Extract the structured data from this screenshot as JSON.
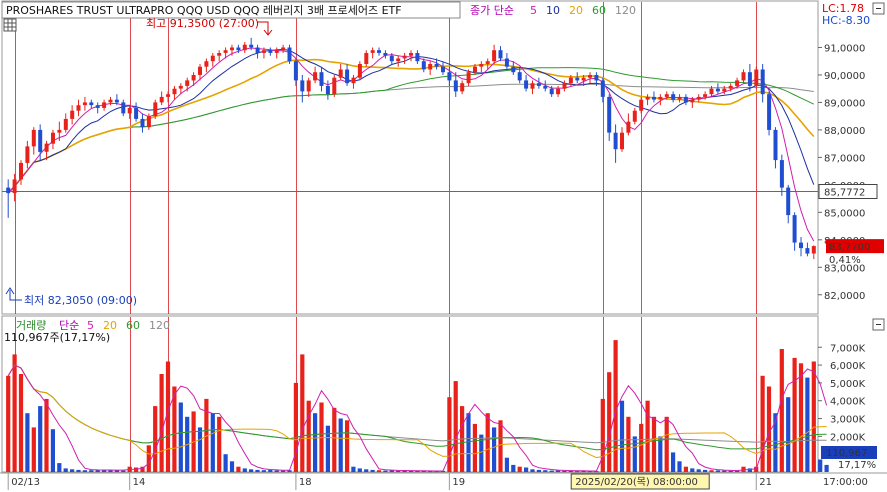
{
  "chart_data": {
    "type": "candlestick",
    "title": "PROSHARES TRUST ULTRAPRO QQQ USD  QQQ 레버리지 3배 프로세어즈 ETF",
    "legend_main": {
      "price_label": "종가",
      "ma_label": "단순",
      "ma_periods": [
        "5",
        "10",
        "20",
        "60",
        "120"
      ],
      "ma_colors": [
        "#d01fb0",
        "#1c2fa0",
        "#e6a300",
        "#2e9a2e",
        "#8c8c8c"
      ]
    },
    "lc_text": "LC:1.78",
    "hc_text": "HC:-8.30",
    "high_annotation": "최고 91,3500 (27:00)",
    "low_annotation": "최저 82,3050 (09:00)",
    "y_ticks": [
      "91,0000",
      "90,0000",
      "89,0000",
      "88,0000",
      "87,0000",
      "86,0000",
      "85,0000",
      "84,0000",
      "83,0000",
      "82,0000"
    ],
    "y_tick_values": [
      91,
      90,
      89,
      88,
      87,
      86,
      85,
      84,
      83,
      82
    ],
    "ylim": [
      81.3,
      92.0
    ],
    "crosshair_price": 85.7772,
    "crosshair_label": "85,7772",
    "last_price": 83.77,
    "last_price_label": "83,7700",
    "change_pct_label": "0,41%",
    "volume_legend": {
      "label": "거래량",
      "ma_label": "단순",
      "ma_periods": [
        "5",
        "20",
        "60",
        "120"
      ],
      "ma_colors": [
        "#d01fb0",
        "#e6a300",
        "#2e9a2e",
        "#8c8c8c"
      ]
    },
    "volume_info": "110,967주(17,17%)",
    "vol_ticks": [
      "7,000K",
      "6,000K",
      "5,000K",
      "4,000K",
      "3,000K",
      "2,000K"
    ],
    "vol_tick_values": [
      7000,
      6000,
      5000,
      4000,
      3000,
      2000
    ],
    "vol_ylim": [
      0,
      7800
    ],
    "vol_last_label": "110,967",
    "vol_last_pct": "17,17%",
    "x_labels": [
      "02/13",
      "14",
      "18",
      "19",
      "21"
    ],
    "x_label_positions": [
      0.5,
      19.5,
      45.5,
      69.5,
      117.5
    ],
    "day_boundaries": [
      1.5,
      19.5,
      25.5,
      45.5,
      69.5,
      93.5,
      99.5,
      117.5
    ],
    "x_cursor_label": "2025/02/20(목) 08:00:00",
    "x_cursor_index": 99.5,
    "x_end_label": "17:00:00",
    "candles": [
      [
        85.9,
        86.2,
        84.8,
        85.7
      ],
      [
        85.7,
        86.4,
        85.4,
        86.2
      ],
      [
        86.2,
        86.9,
        86.0,
        86.8
      ],
      [
        86.8,
        87.6,
        86.6,
        87.4
      ],
      [
        87.4,
        88.1,
        87.1,
        88.0
      ],
      [
        88.0,
        88.2,
        86.9,
        87.2
      ],
      [
        87.2,
        87.6,
        86.9,
        87.5
      ],
      [
        87.5,
        88.0,
        87.3,
        87.9
      ],
      [
        87.9,
        88.3,
        87.6,
        88.0
      ],
      [
        88.0,
        88.6,
        87.9,
        88.4
      ],
      [
        88.4,
        88.9,
        88.2,
        88.7
      ],
      [
        88.7,
        89.1,
        88.5,
        88.9
      ],
      [
        88.9,
        89.2,
        88.7,
        89.0
      ],
      [
        89.0,
        89.1,
        88.8,
        88.9
      ],
      [
        88.9,
        89.0,
        88.6,
        88.8
      ],
      [
        88.8,
        89.1,
        88.7,
        89.0
      ],
      [
        89.0,
        89.2,
        88.9,
        89.1
      ],
      [
        89.1,
        89.3,
        88.9,
        89.0
      ],
      [
        89.0,
        89.1,
        88.5,
        88.6
      ],
      [
        88.6,
        88.9,
        88.4,
        88.8
      ],
      [
        88.8,
        89.0,
        88.3,
        88.4
      ],
      [
        88.4,
        88.6,
        87.9,
        88.1
      ],
      [
        88.1,
        88.6,
        88.0,
        88.5
      ],
      [
        88.5,
        89.1,
        88.4,
        89.0
      ],
      [
        89.0,
        89.4,
        88.9,
        89.2
      ],
      [
        89.2,
        89.4,
        89.0,
        89.3
      ],
      [
        89.3,
        89.6,
        89.1,
        89.5
      ],
      [
        89.5,
        89.7,
        89.3,
        89.6
      ],
      [
        89.6,
        89.9,
        89.4,
        89.8
      ],
      [
        89.8,
        90.1,
        89.6,
        90.0
      ],
      [
        90.0,
        90.4,
        89.8,
        90.3
      ],
      [
        90.3,
        90.6,
        90.1,
        90.5
      ],
      [
        90.5,
        90.8,
        90.3,
        90.7
      ],
      [
        90.7,
        90.9,
        90.5,
        90.8
      ],
      [
        90.8,
        91.0,
        90.6,
        90.9
      ],
      [
        90.9,
        91.1,
        90.7,
        91.0
      ],
      [
        91.0,
        91.1,
        90.8,
        90.9
      ],
      [
        90.9,
        91.2,
        90.8,
        91.1
      ],
      [
        91.1,
        91.35,
        90.9,
        91.0
      ],
      [
        91.0,
        91.1,
        90.6,
        90.8
      ],
      [
        90.8,
        91.0,
        90.6,
        90.9
      ],
      [
        90.9,
        91.0,
        90.7,
        90.8
      ],
      [
        90.8,
        91.0,
        90.6,
        90.9
      ],
      [
        90.9,
        91.1,
        90.8,
        91.0
      ],
      [
        91.0,
        91.1,
        90.4,
        90.5
      ],
      [
        90.5,
        90.6,
        89.6,
        89.8
      ],
      [
        89.8,
        90.0,
        89.0,
        89.4
      ],
      [
        89.4,
        89.9,
        89.2,
        89.8
      ],
      [
        89.8,
        90.3,
        89.7,
        90.1
      ],
      [
        90.1,
        90.3,
        89.4,
        89.6
      ],
      [
        89.6,
        89.8,
        89.1,
        89.3
      ],
      [
        89.3,
        90.0,
        89.2,
        89.9
      ],
      [
        89.9,
        90.4,
        89.8,
        90.2
      ],
      [
        90.2,
        90.4,
        89.6,
        89.7
      ],
      [
        89.7,
        90.0,
        89.5,
        89.9
      ],
      [
        89.9,
        90.5,
        89.8,
        90.4
      ],
      [
        90.4,
        90.9,
        90.3,
        90.8
      ],
      [
        90.8,
        91.0,
        90.6,
        90.9
      ],
      [
        90.9,
        91.0,
        90.7,
        90.8
      ],
      [
        90.8,
        90.9,
        90.6,
        90.7
      ],
      [
        90.7,
        90.8,
        90.4,
        90.5
      ],
      [
        90.5,
        90.7,
        90.3,
        90.6
      ],
      [
        90.6,
        90.8,
        90.4,
        90.7
      ],
      [
        90.7,
        90.9,
        90.5,
        90.8
      ],
      [
        90.8,
        90.9,
        90.4,
        90.5
      ],
      [
        90.5,
        90.6,
        90.1,
        90.2
      ],
      [
        90.2,
        90.5,
        90.0,
        90.4
      ],
      [
        90.4,
        90.6,
        90.2,
        90.3
      ],
      [
        90.3,
        90.5,
        90.0,
        90.1
      ],
      [
        90.1,
        90.3,
        89.6,
        89.8
      ],
      [
        89.8,
        90.1,
        89.2,
        89.4
      ],
      [
        89.4,
        89.8,
        89.3,
        89.7
      ],
      [
        89.7,
        90.2,
        89.6,
        90.1
      ],
      [
        90.1,
        90.4,
        90.0,
        90.3
      ],
      [
        90.3,
        90.5,
        90.1,
        90.4
      ],
      [
        90.4,
        90.6,
        90.2,
        90.5
      ],
      [
        90.5,
        91.1,
        90.4,
        90.9
      ],
      [
        90.9,
        91.05,
        90.5,
        90.6
      ],
      [
        90.6,
        90.8,
        90.2,
        90.3
      ],
      [
        90.3,
        90.5,
        90.0,
        90.1
      ],
      [
        90.1,
        90.3,
        89.7,
        89.8
      ],
      [
        89.8,
        90.0,
        89.4,
        89.5
      ],
      [
        89.5,
        89.8,
        89.3,
        89.7
      ],
      [
        89.7,
        89.9,
        89.5,
        89.6
      ],
      [
        89.6,
        89.8,
        89.4,
        89.5
      ],
      [
        89.5,
        89.6,
        89.2,
        89.3
      ],
      [
        89.3,
        89.6,
        89.2,
        89.5
      ],
      [
        89.5,
        89.8,
        89.4,
        89.7
      ],
      [
        89.7,
        90.0,
        89.6,
        89.9
      ],
      [
        89.9,
        90.1,
        89.7,
        89.8
      ],
      [
        89.8,
        90.0,
        89.6,
        89.9
      ],
      [
        89.9,
        90.1,
        89.7,
        90.0
      ],
      [
        90.0,
        90.1,
        89.6,
        89.8
      ],
      [
        89.8,
        89.9,
        89.0,
        89.2
      ],
      [
        89.2,
        89.3,
        87.6,
        87.9
      ],
      [
        87.9,
        88.2,
        86.8,
        87.3
      ],
      [
        87.3,
        88.1,
        87.2,
        87.9
      ],
      [
        87.9,
        88.6,
        87.8,
        88.3
      ],
      [
        88.3,
        88.8,
        88.2,
        88.7
      ],
      [
        88.7,
        89.2,
        88.6,
        89.1
      ],
      [
        89.1,
        89.3,
        88.9,
        89.2
      ],
      [
        89.2,
        89.4,
        89.0,
        89.1
      ],
      [
        89.1,
        89.3,
        88.9,
        89.2
      ],
      [
        89.2,
        89.4,
        89.1,
        89.3
      ],
      [
        89.3,
        89.4,
        89.0,
        89.1
      ],
      [
        89.1,
        89.3,
        89.0,
        89.2
      ],
      [
        89.2,
        89.3,
        88.9,
        89.0
      ],
      [
        89.0,
        89.2,
        88.8,
        89.1
      ],
      [
        89.1,
        89.3,
        89.0,
        89.2
      ],
      [
        89.2,
        89.4,
        89.1,
        89.3
      ],
      [
        89.3,
        89.6,
        89.2,
        89.5
      ],
      [
        89.5,
        89.7,
        89.3,
        89.4
      ],
      [
        89.4,
        89.6,
        89.3,
        89.5
      ],
      [
        89.5,
        89.7,
        89.4,
        89.6
      ],
      [
        89.6,
        89.9,
        89.5,
        89.8
      ],
      [
        89.8,
        90.2,
        89.7,
        90.1
      ],
      [
        90.1,
        90.4,
        89.4,
        89.6
      ],
      [
        89.6,
        90.3,
        89.5,
        90.2
      ],
      [
        90.2,
        90.4,
        89.0,
        89.3
      ],
      [
        89.3,
        89.4,
        87.8,
        88.0
      ],
      [
        88.0,
        88.1,
        86.6,
        86.9
      ],
      [
        86.9,
        87.1,
        85.6,
        85.9
      ],
      [
        85.9,
        86.0,
        84.6,
        84.9
      ],
      [
        84.9,
        85.0,
        83.6,
        83.9
      ],
      [
        83.9,
        84.1,
        83.4,
        83.7
      ],
      [
        83.7,
        83.9,
        83.4,
        83.5
      ],
      [
        83.5,
        83.8,
        83.3,
        83.77
      ]
    ],
    "volumes": [
      [
        5400,
        1
      ],
      [
        6600,
        1
      ],
      [
        5500,
        1
      ],
      [
        3300,
        0
      ],
      [
        2500,
        1
      ],
      [
        3700,
        0
      ],
      [
        4100,
        1
      ],
      [
        2400,
        0
      ],
      [
        500,
        0
      ],
      [
        200,
        0
      ],
      [
        150,
        0
      ],
      [
        120,
        0
      ],
      [
        100,
        0
      ],
      [
        100,
        0
      ],
      [
        120,
        0
      ],
      [
        130,
        0
      ],
      [
        100,
        0
      ],
      [
        90,
        0
      ],
      [
        80,
        0
      ],
      [
        300,
        1
      ],
      [
        250,
        1
      ],
      [
        300,
        1
      ],
      [
        1500,
        1
      ],
      [
        3700,
        1
      ],
      [
        5500,
        1
      ],
      [
        6200,
        1
      ],
      [
        4800,
        1
      ],
      [
        3900,
        0
      ],
      [
        3100,
        0
      ],
      [
        3400,
        1
      ],
      [
        2500,
        0
      ],
      [
        4100,
        1
      ],
      [
        3300,
        0
      ],
      [
        3100,
        1
      ],
      [
        1000,
        0
      ],
      [
        600,
        0
      ],
      [
        300,
        1
      ],
      [
        200,
        0
      ],
      [
        150,
        0
      ],
      [
        120,
        0
      ],
      [
        100,
        0
      ],
      [
        120,
        0
      ],
      [
        90,
        0
      ],
      [
        80,
        0
      ],
      [
        100,
        0
      ],
      [
        5000,
        1
      ],
      [
        6600,
        1
      ],
      [
        4000,
        1
      ],
      [
        3300,
        0
      ],
      [
        3900,
        1
      ],
      [
        2600,
        0
      ],
      [
        3600,
        1
      ],
      [
        3000,
        0
      ],
      [
        2900,
        1
      ],
      [
        300,
        0
      ],
      [
        200,
        0
      ],
      [
        150,
        0
      ],
      [
        120,
        0
      ],
      [
        100,
        1
      ],
      [
        80,
        0
      ],
      [
        90,
        0
      ],
      [
        70,
        0
      ],
      [
        80,
        0
      ],
      [
        60,
        0
      ],
      [
        70,
        0
      ],
      [
        60,
        0
      ],
      [
        50,
        0
      ],
      [
        50,
        0
      ],
      [
        60,
        0
      ],
      [
        4200,
        1
      ],
      [
        5100,
        1
      ],
      [
        3700,
        1
      ],
      [
        3300,
        0
      ],
      [
        2700,
        1
      ],
      [
        2100,
        0
      ],
      [
        3300,
        1
      ],
      [
        2500,
        0
      ],
      [
        2900,
        1
      ],
      [
        800,
        0
      ],
      [
        400,
        0
      ],
      [
        300,
        1
      ],
      [
        250,
        0
      ],
      [
        150,
        0
      ],
      [
        120,
        0
      ],
      [
        100,
        0
      ],
      [
        80,
        0
      ],
      [
        90,
        0
      ],
      [
        70,
        0
      ],
      [
        60,
        0
      ],
      [
        50,
        0
      ],
      [
        60,
        0
      ],
      [
        50,
        0
      ],
      [
        50,
        0
      ],
      [
        4100,
        1
      ],
      [
        5600,
        1
      ],
      [
        7400,
        1
      ],
      [
        4000,
        0
      ],
      [
        3100,
        1
      ],
      [
        2000,
        0
      ],
      [
        2700,
        1
      ],
      [
        4000,
        1
      ],
      [
        3100,
        1
      ],
      [
        2000,
        0
      ],
      [
        3100,
        1
      ],
      [
        1100,
        0
      ],
      [
        600,
        0
      ],
      [
        300,
        1
      ],
      [
        200,
        0
      ],
      [
        150,
        0
      ],
      [
        120,
        0
      ],
      [
        100,
        1
      ],
      [
        90,
        0
      ],
      [
        80,
        0
      ],
      [
        70,
        0
      ],
      [
        60,
        0
      ],
      [
        300,
        1
      ],
      [
        200,
        0
      ],
      [
        300,
        1
      ],
      [
        5400,
        1
      ],
      [
        4800,
        1
      ],
      [
        3300,
        0
      ],
      [
        6900,
        1
      ],
      [
        4200,
        0
      ],
      [
        6400,
        1
      ],
      [
        6100,
        1
      ],
      [
        5300,
        0
      ],
      [
        6200,
        1
      ],
      [
        700,
        0
      ],
      [
        400,
        0
      ]
    ]
  }
}
